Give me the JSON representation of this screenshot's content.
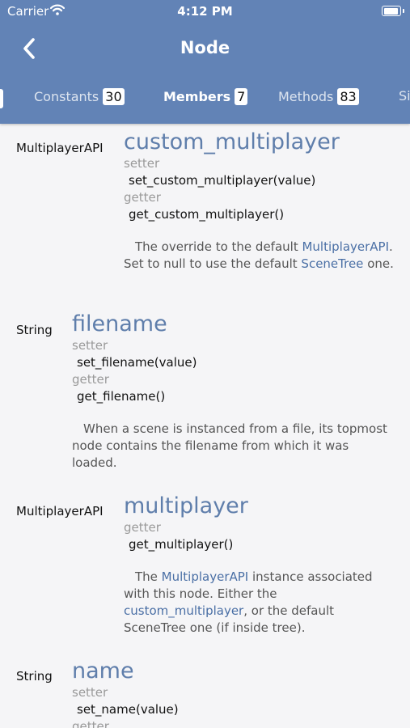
{
  "status": {
    "carrier": "Carrier",
    "time": "4:12 PM"
  },
  "nav": {
    "title": "Node"
  },
  "tabs": [
    {
      "label": "Constants",
      "count": "30"
    },
    {
      "label": "Members",
      "count": "7"
    },
    {
      "label": "Methods",
      "count": "83"
    },
    {
      "label": "Si"
    }
  ],
  "members": [
    {
      "type": "MultiplayerAPI",
      "name": "custom_multiplayer",
      "setter_label": "setter",
      "setter": "set_custom_multiplayer(value)",
      "getter_label": "getter",
      "getter": "get_custom_multiplayer()",
      "desc": {
        "t1": "The override to the default ",
        "l1": "MultiplayerAPI",
        "t2": ". Set to null to use the default ",
        "l2": "SceneTree",
        "t3": " one."
      }
    },
    {
      "type": "String",
      "name": "filename",
      "setter_label": "setter",
      "setter": "set_filename(value)",
      "getter_label": "getter",
      "getter": "get_filename()",
      "desc": {
        "t1": "When a scene is instanced from a file, its topmost node contains the filename from which it was loaded."
      }
    },
    {
      "type": "MultiplayerAPI",
      "name": "multiplayer",
      "getter_label": "getter",
      "getter": "get_multiplayer()",
      "desc": {
        "t1": "The ",
        "l1": "MultiplayerAPI",
        "t2": " instance associated with this node. Either the ",
        "l2": "custom_multiplayer",
        "t3": ", or the default SceneTree one (if inside tree)."
      }
    },
    {
      "type": "String",
      "name": "name",
      "setter_label": "setter",
      "setter": "set_name(value)",
      "getter_label": "getter"
    }
  ]
}
